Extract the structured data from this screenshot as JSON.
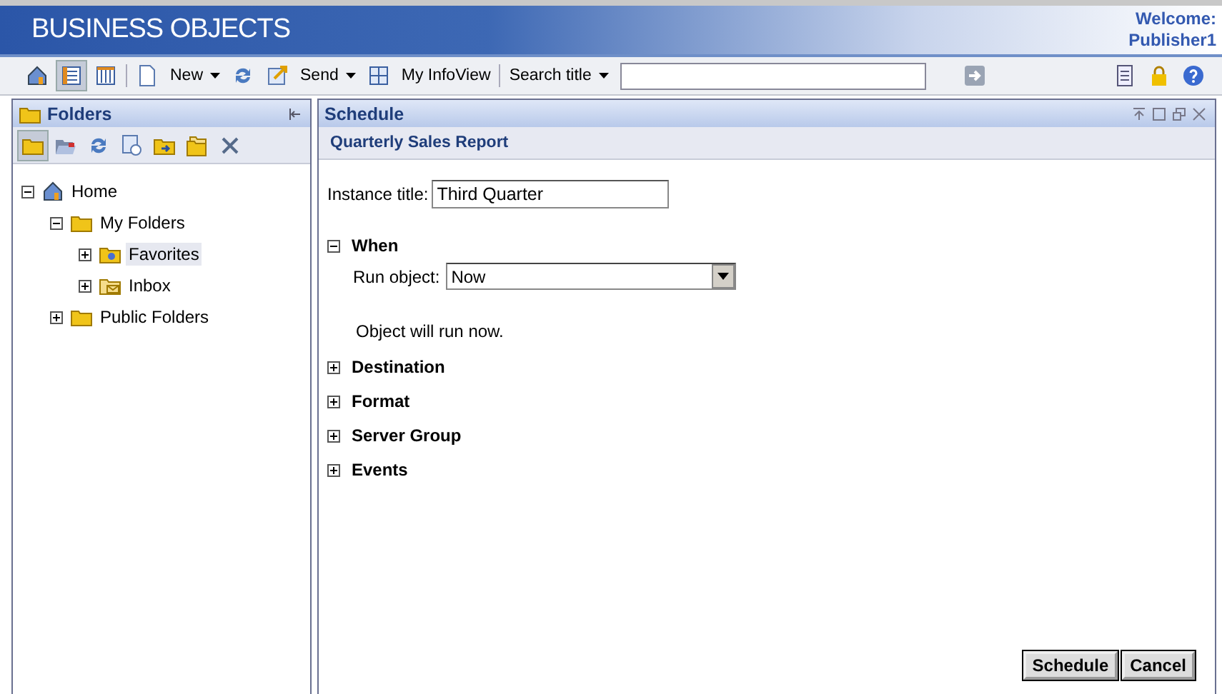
{
  "header": {
    "logo": "BUSINESS OBJECTS",
    "welcome": "Welcome:",
    "user": "Publisher1"
  },
  "toolbar": {
    "new": "New",
    "send": "Send",
    "infoview": "My InfoView",
    "search_label": "Search title"
  },
  "folders": {
    "title": "Folders",
    "tree": [
      {
        "label": "Home",
        "kind": "home",
        "expanded": true,
        "selected": false,
        "children": [
          {
            "label": "My Folders",
            "kind": "folder",
            "expanded": true,
            "selected": false,
            "children": [
              {
                "label": "Favorites",
                "kind": "favorites",
                "expanded": false,
                "selected": true
              },
              {
                "label": "Inbox",
                "kind": "inbox",
                "expanded": false,
                "selected": false
              }
            ]
          },
          {
            "label": "Public Folders",
            "kind": "folder",
            "expanded": false,
            "selected": false
          }
        ]
      }
    ]
  },
  "schedule": {
    "title": "Schedule",
    "subtitle": "Quarterly Sales Report",
    "instance_label": "Instance title:",
    "instance_value": "Third Quarter",
    "sections": [
      {
        "label": "When",
        "expanded": true,
        "run_label": "Run object:",
        "run_value": "Now",
        "note": "Object will run now."
      },
      {
        "label": "Destination",
        "expanded": false
      },
      {
        "label": "Format",
        "expanded": false
      },
      {
        "label": "Server Group",
        "expanded": false
      },
      {
        "label": "Events",
        "expanded": false
      }
    ],
    "buttons": [
      "Schedule",
      "Cancel"
    ]
  }
}
